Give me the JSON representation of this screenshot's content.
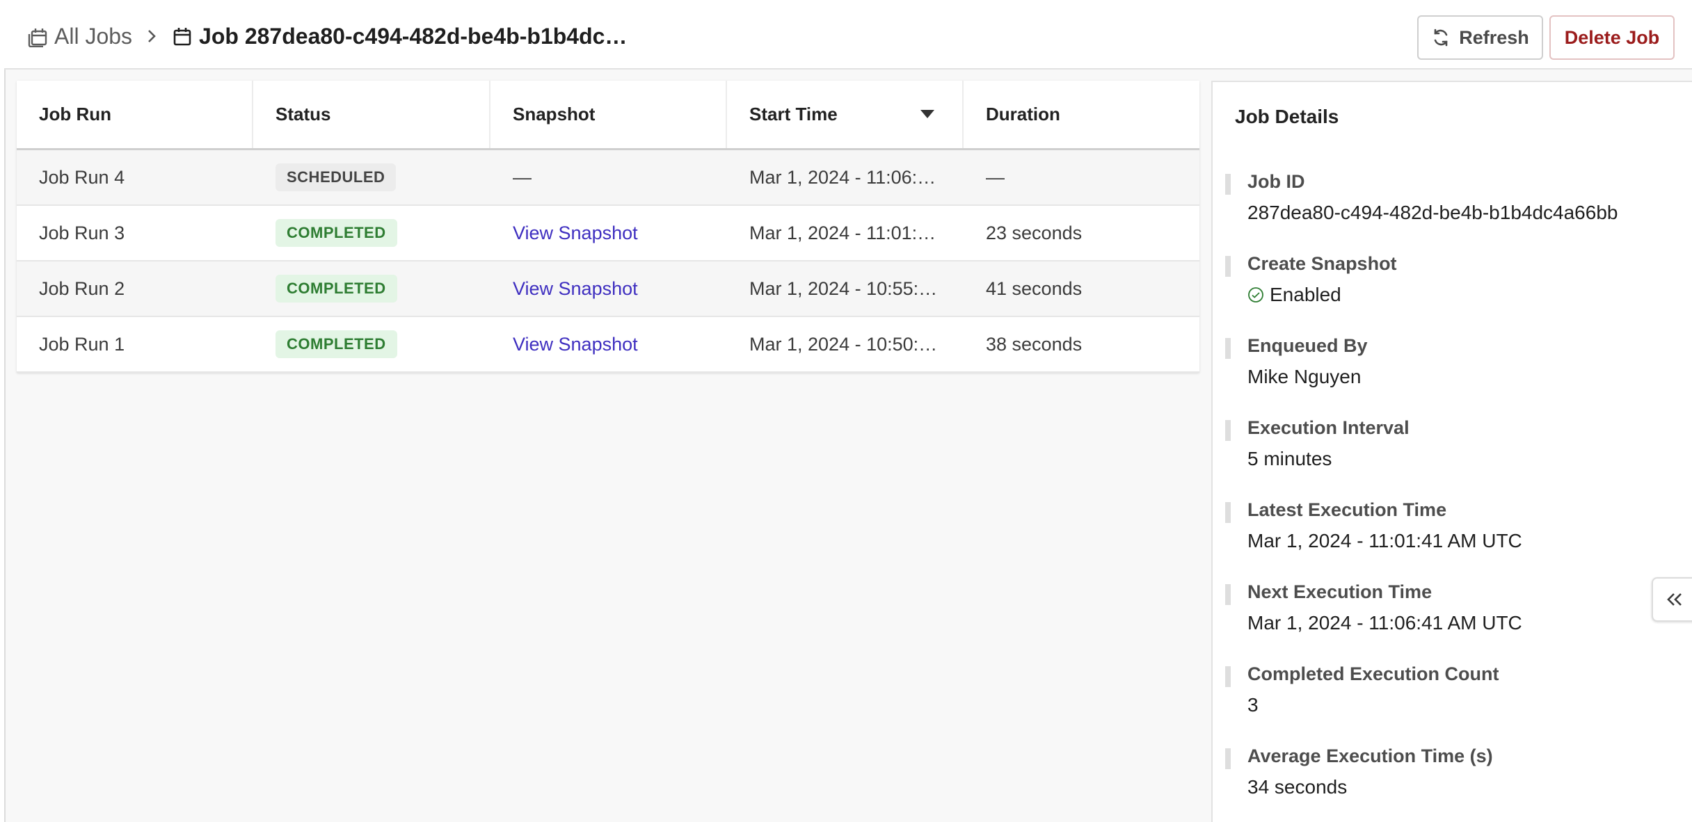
{
  "breadcrumb": {
    "root_label": "All Jobs",
    "current_label": "Job 287dea80-c494-482d-be4b-b1b4dc…"
  },
  "toolbar": {
    "refresh_label": "Refresh",
    "delete_label": "Delete Job"
  },
  "table": {
    "columns": [
      "Job Run",
      "Status",
      "Snapshot",
      "Start Time",
      "Duration"
    ],
    "sorted_column": "Start Time",
    "sort_direction": "descending",
    "rows": [
      {
        "run": "Job Run 4",
        "status": "SCHEDULED",
        "snapshot": "—",
        "start": "Mar 1, 2024 - 11:06:…",
        "duration": "—"
      },
      {
        "run": "Job Run 3",
        "status": "COMPLETED",
        "snapshot": "View Snapshot",
        "start": "Mar 1, 2024 - 11:01:…",
        "duration": "23 seconds"
      },
      {
        "run": "Job Run 2",
        "status": "COMPLETED",
        "snapshot": "View Snapshot",
        "start": "Mar 1, 2024 - 10:55:…",
        "duration": "41 seconds"
      },
      {
        "run": "Job Run 1",
        "status": "COMPLETED",
        "snapshot": "View Snapshot",
        "start": "Mar 1, 2024 - 10:50:…",
        "duration": "38 seconds"
      }
    ]
  },
  "details": {
    "title": "Job Details",
    "fields": [
      {
        "label": "Job ID",
        "value": "287dea80-c494-482d-be4b-b1b4dc4a66bb"
      },
      {
        "label": "Create Snapshot",
        "value": "Enabled"
      },
      {
        "label": "Enqueued By",
        "value": "Mike Nguyen"
      },
      {
        "label": "Execution Interval",
        "value": "5 minutes"
      },
      {
        "label": "Latest Execution Time",
        "value": "Mar 1, 2024 - 11:01:41 AM UTC"
      },
      {
        "label": "Next Execution Time",
        "value": "Mar 1, 2024 - 11:06:41 AM UTC"
      },
      {
        "label": "Completed Execution Count",
        "value": "3"
      },
      {
        "label": "Average Execution Time (s)",
        "value": "34 seconds"
      }
    ]
  },
  "icons": {
    "all_jobs": "calendar-stack-icon",
    "job": "calendar-icon",
    "separator": "chevron-right-icon",
    "refresh": "refresh-icon",
    "sort": "caret-down-icon",
    "enabled": "check-circle-icon",
    "collapse": "double-chevron-left-icon"
  },
  "colors": {
    "link": "#3f2fc0",
    "completed_text": "#2e7d32",
    "completed_bg": "#e3f5e5",
    "scheduled_bg": "#ececec",
    "delete_text": "#9b1c1c"
  }
}
